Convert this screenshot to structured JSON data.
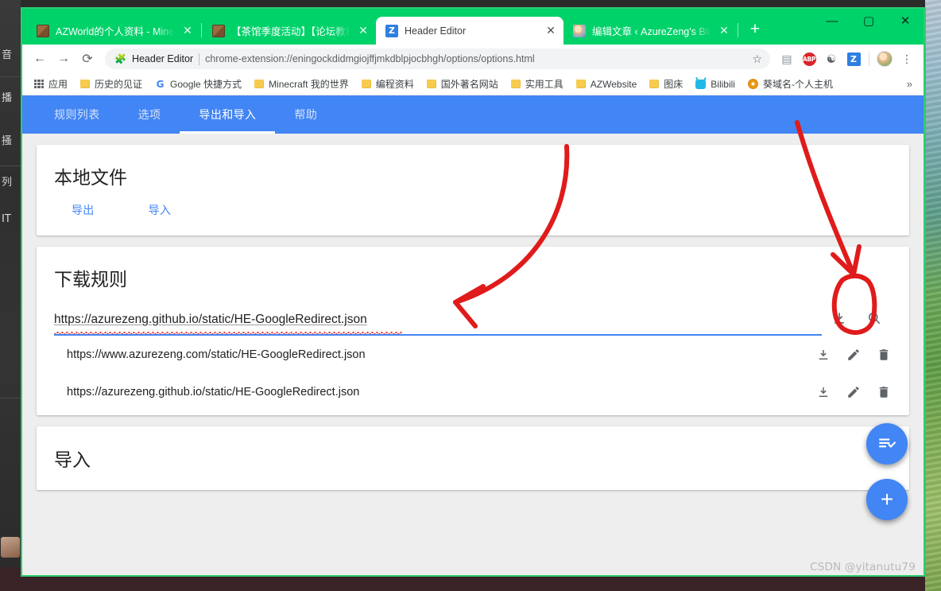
{
  "browser": {
    "tabs": [
      {
        "title": "AZWorld的个人资料 - Minecraft",
        "favicon": "minecraft-icon",
        "active": false,
        "close_label": "✕"
      },
      {
        "title": "【茶馆季度活动】【论坛教程组】",
        "favicon": "minecraft-icon",
        "active": false,
        "close_label": "✕"
      },
      {
        "title": "Header Editor",
        "favicon": "header-editor-icon",
        "active": true,
        "close_label": "✕"
      },
      {
        "title": "编辑文章 ‹ AzureZeng's Blog —",
        "favicon": "blog-avatar-icon",
        "active": false,
        "close_label": "✕"
      }
    ],
    "new_tab_label": "+",
    "window_controls": {
      "minimize": "—",
      "maximize": "▢",
      "close": "✕"
    },
    "nav": {
      "back": "←",
      "forward": "→",
      "reload": "⟳"
    },
    "omnibox": {
      "extension_icon": "puzzle-piece-icon",
      "extension_name": "Header Editor",
      "url": "chrome-extension://eningockdidmgiojffjmkdblpjocbhgh/options/options.html",
      "star": "☆"
    },
    "toolbar_icons": [
      {
        "name": "extensions-icon",
        "glyph": "▦"
      },
      {
        "name": "adblock-plus-icon",
        "glyph": "ABP"
      },
      {
        "name": "unknown-extension-icon",
        "glyph": "☯"
      },
      {
        "name": "header-editor-extension-icon",
        "glyph": "Z"
      },
      {
        "name": "profile-avatar",
        "glyph": ""
      },
      {
        "name": "chrome-menu-icon",
        "glyph": "⋮"
      }
    ],
    "bookmarks": [
      {
        "label": "应用",
        "icon": "apps-grid-icon"
      },
      {
        "label": "历史的见证",
        "icon": "folder-icon"
      },
      {
        "label": "Google 快捷方式",
        "icon": "google-icon"
      },
      {
        "label": "Minecraft 我的世界",
        "icon": "folder-icon"
      },
      {
        "label": "编程资料",
        "icon": "folder-icon"
      },
      {
        "label": "国外著名网站",
        "icon": "folder-icon"
      },
      {
        "label": "实用工具",
        "icon": "folder-icon"
      },
      {
        "label": "AZWebsite",
        "icon": "folder-icon"
      },
      {
        "label": "图床",
        "icon": "folder-icon"
      },
      {
        "label": "Bilibili",
        "icon": "bilibili-icon"
      },
      {
        "label": "葵域名-个人主机",
        "icon": "kuiyuming-icon"
      }
    ],
    "bookmarks_overflow": "»"
  },
  "app": {
    "tabs": [
      {
        "label": "规则列表",
        "active": false
      },
      {
        "label": "选项",
        "active": false
      },
      {
        "label": "导出和导入",
        "active": true
      },
      {
        "label": "帮助",
        "active": false
      }
    ],
    "local_file": {
      "title": "本地文件",
      "export_label": "导出",
      "import_label": "导入"
    },
    "download_rules": {
      "title": "下载规则",
      "input_value": "https://azurezeng.github.io/static/HE-GoogleRedirect.json",
      "download_icon": "download-icon",
      "search_icon": "search-icon",
      "rows": [
        {
          "url": "https://www.azurezeng.com/static/HE-GoogleRedirect.json",
          "actions": [
            "download-icon",
            "edit-pencil-icon",
            "delete-trash-icon"
          ]
        },
        {
          "url": "https://azurezeng.github.io/static/HE-GoogleRedirect.json",
          "actions": [
            "download-icon",
            "edit-pencil-icon",
            "delete-trash-icon"
          ]
        }
      ]
    },
    "import_section": {
      "title": "导入"
    },
    "fabs": [
      {
        "name": "batch-select-fab",
        "icon": "playlist-check-icon"
      },
      {
        "name": "add-rule-fab",
        "icon": "plus-icon",
        "label": "+"
      }
    ],
    "colors": {
      "accent": "#4285f4",
      "titlebar": "#00d26a",
      "page_bg": "#eeeeee",
      "annotation_red": "#e01b1b"
    }
  },
  "background": {
    "side_labels": [
      "音",
      "播",
      "搔",
      "列",
      "IT"
    ]
  },
  "watermark": "CSDN @yitanutu79"
}
